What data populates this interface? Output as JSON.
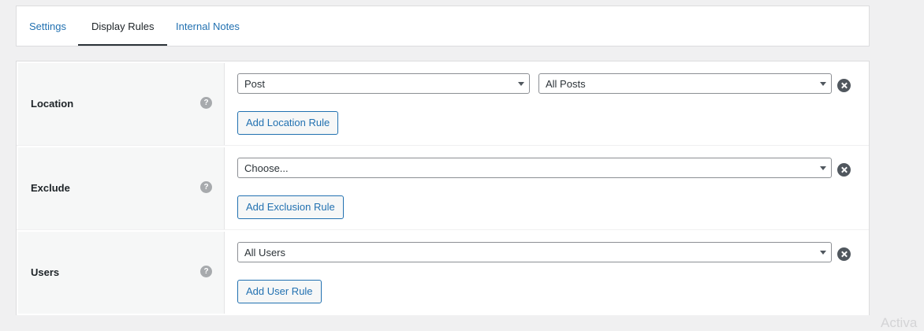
{
  "tabs": [
    {
      "label": "Settings",
      "active": false
    },
    {
      "label": "Display Rules",
      "active": true
    },
    {
      "label": "Internal Notes",
      "active": false
    }
  ],
  "rules": {
    "location": {
      "label": "Location",
      "help_glyph": "?",
      "type_select": "Post",
      "value_select": "All Posts",
      "add_button": "Add Location Rule"
    },
    "exclude": {
      "label": "Exclude",
      "help_glyph": "?",
      "select": "Choose...",
      "add_button": "Add Exclusion Rule"
    },
    "users": {
      "label": "Users",
      "help_glyph": "?",
      "select": "All Users",
      "add_button": "Add User Rule"
    }
  },
  "watermark": "Activa",
  "icons": {
    "help": "question-circle-icon",
    "remove": "close-circle-icon",
    "dropdown": "chevron-down-icon"
  },
  "colors": {
    "link": "#2271b1",
    "background": "#f0f0f1",
    "label_cell": "#f6f7f7"
  }
}
